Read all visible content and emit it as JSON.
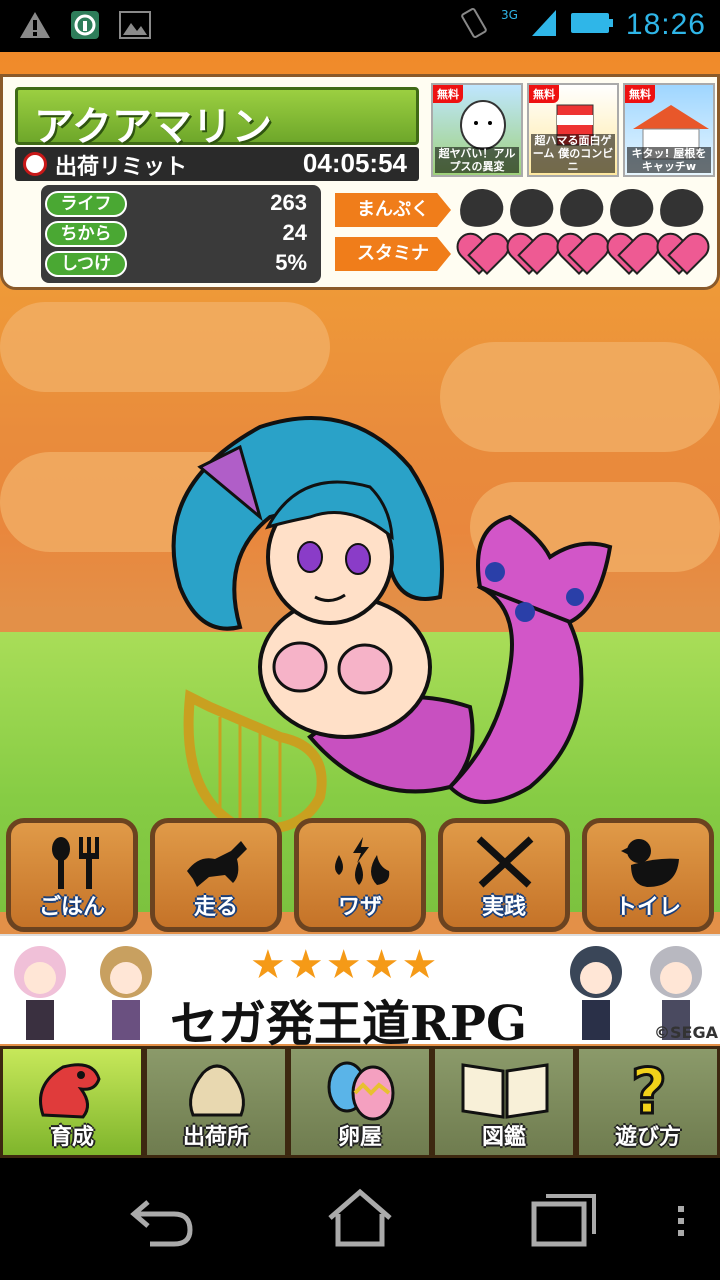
{
  "status_bar": {
    "time": "18:26",
    "network": "3G"
  },
  "hud": {
    "character_name": "アクアマリン",
    "limit_label": "出荷リミット",
    "limit_time": "04:05:54",
    "stats": [
      {
        "label": "ライフ",
        "value": "263"
      },
      {
        "label": "ちから",
        "value": "24"
      },
      {
        "label": "しつけ",
        "value": "5%"
      }
    ],
    "gauges": [
      {
        "label": "まんぷく",
        "icon": "meat-icon",
        "count": 5
      },
      {
        "label": "スタミナ",
        "icon": "heart-icon",
        "count": 5
      }
    ],
    "ads": [
      {
        "badge": "無料",
        "text": "超ヤバい！アルプスの異変"
      },
      {
        "badge": "無料",
        "text": "超ハマる面白ゲーム 僕のコンビニ"
      },
      {
        "badge": "無料",
        "text": "キタッ! 屋根をキャッチw"
      }
    ]
  },
  "actions": [
    {
      "label": "ごはん",
      "icon": "fork-spoon-icon"
    },
    {
      "label": "走る",
      "icon": "running-dog-icon"
    },
    {
      "label": "ワザ",
      "icon": "elements-icon"
    },
    {
      "label": "実践",
      "icon": "crossed-swords-icon"
    },
    {
      "label": "トイレ",
      "icon": "duck-icon"
    }
  ],
  "banner": {
    "stars": "★★★★★",
    "text": "セガ発王道RPG",
    "copyright": "©SEGA"
  },
  "tabs": [
    {
      "label": "育成",
      "icon": "dinosaur-icon",
      "active": true
    },
    {
      "label": "出荷所",
      "icon": "sack-icon",
      "active": false
    },
    {
      "label": "卵屋",
      "icon": "eggs-icon",
      "active": false
    },
    {
      "label": "図鑑",
      "icon": "book-icon",
      "active": false
    },
    {
      "label": "遊び方",
      "icon": "question-icon",
      "active": false
    }
  ],
  "colors": {
    "accent": "#f07d1a",
    "hud_green": "#6ea72a",
    "status_blue": "#2fb6e8"
  }
}
